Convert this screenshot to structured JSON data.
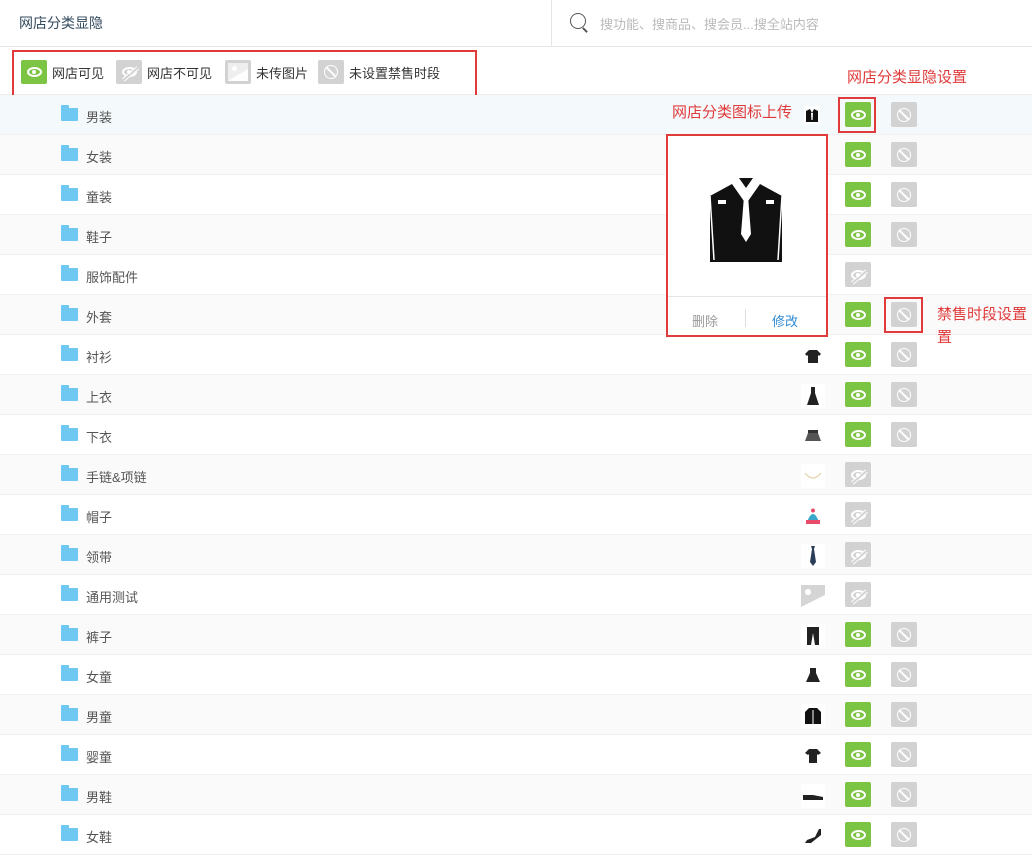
{
  "header": {
    "title": "网店分类显隐",
    "search_placeholder": "搜功能、搜商品、搜会员...搜全站内容"
  },
  "legend": {
    "visible": "网店可见",
    "invisible": "网店不可见",
    "no_image": "未传图片",
    "no_time": "未设置禁售时段"
  },
  "annotations": {
    "visibility_setting": "网店分类显隐设置",
    "icon_upload": "网店分类图标上传",
    "time_setting_1": "禁售时段设置",
    "time_setting_2": "置"
  },
  "popup": {
    "delete": "删除",
    "modify": "修改"
  },
  "rows": [
    {
      "name": "男装",
      "visible": true,
      "icon": "suit-icon"
    },
    {
      "name": "女装",
      "visible": true,
      "icon": "none"
    },
    {
      "name": "童装",
      "visible": true,
      "icon": "none"
    },
    {
      "name": "鞋子",
      "visible": true,
      "icon": "none"
    },
    {
      "name": "服饰配件",
      "visible": false,
      "icon": "none"
    },
    {
      "name": "外套",
      "visible": true,
      "icon": "none"
    },
    {
      "name": "衬衫",
      "visible": true,
      "icon": "shirt-icon"
    },
    {
      "name": "上衣",
      "visible": true,
      "icon": "dress-icon"
    },
    {
      "name": "下衣",
      "visible": true,
      "icon": "skirt-icon"
    },
    {
      "name": "手链&项链",
      "visible": false,
      "icon": "necklace-icon"
    },
    {
      "name": "帽子",
      "visible": false,
      "icon": "hat-icon"
    },
    {
      "name": "领带",
      "visible": false,
      "icon": "tie-icon"
    },
    {
      "name": "通用测试",
      "visible": false,
      "icon": "placeholder-image-icon"
    },
    {
      "name": "裤子",
      "visible": true,
      "icon": "pants-icon"
    },
    {
      "name": "女童",
      "visible": true,
      "icon": "girl-dress-icon"
    },
    {
      "name": "男童",
      "visible": true,
      "icon": "jacket-icon"
    },
    {
      "name": "婴童",
      "visible": true,
      "icon": "baby-clothes-icon"
    },
    {
      "name": "男鞋",
      "visible": true,
      "icon": "shoe-icon"
    },
    {
      "name": "女鞋",
      "visible": true,
      "icon": "heel-icon"
    }
  ],
  "colors": {
    "accent_green": "#7cc443",
    "annotation_red": "#e03a3a",
    "link_blue": "#2e8bd4"
  }
}
